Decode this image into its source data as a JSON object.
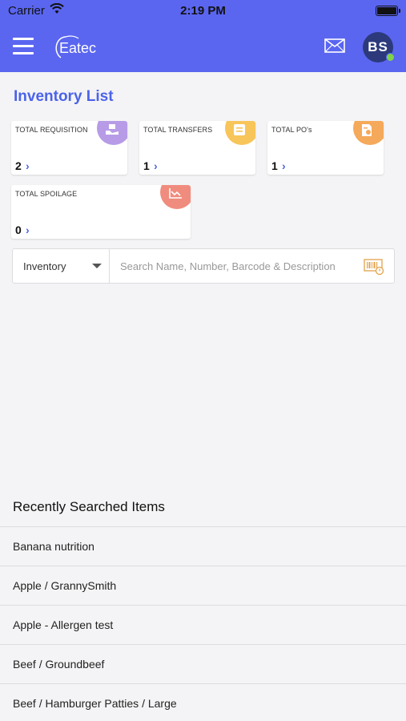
{
  "status_bar": {
    "carrier": "Carrier",
    "time": "2:19 PM"
  },
  "app_bar": {
    "logo_text": "Eatec",
    "avatar_initials": "BS",
    "background_color": "#5a66f0"
  },
  "page": {
    "title": "Inventory List"
  },
  "cards": [
    {
      "label": "TOTAL REQUISITION",
      "count": "2",
      "icon": "requisition-icon",
      "badge_color": "#b79be6"
    },
    {
      "label": "TOTAL TRANSFERS",
      "count": "1",
      "icon": "transfer-icon",
      "badge_color": "#f7c55a"
    },
    {
      "label": "TOTAL PO's",
      "count": "1",
      "icon": "purchase-order-icon",
      "badge_color": "#f5a95a"
    },
    {
      "label": "TOTAL SPOILAGE",
      "count": "0",
      "icon": "spoilage-chart-icon",
      "badge_color": "#f08c7e"
    }
  ],
  "search": {
    "filter_value": "Inventory",
    "placeholder": "Search Name, Number, Barcode & Description"
  },
  "recent": {
    "title": "Recently Searched Items",
    "items": [
      "Banana nutrition",
      "Apple / GrannySmith",
      "Apple - Allergen test",
      "Beef / Groundbeef",
      "Beef / Hamburger Patties / Large"
    ]
  }
}
